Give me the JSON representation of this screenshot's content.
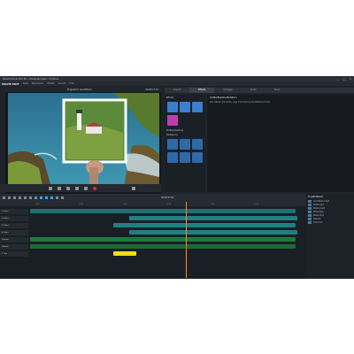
{
  "window": {
    "title": "MAGIX Movie Edit Pro - Beispielprojekt - Timeline",
    "logo": "MOVIE EDIT",
    "window_controls": [
      "_",
      "□",
      "×"
    ]
  },
  "menu": {
    "items": [
      "Datei",
      "Bearbeiten",
      "Effekte",
      "Ansicht",
      "Hilfe"
    ]
  },
  "monitor": {
    "header_label": "Programm: Leuchtturm",
    "timecode": "00:00:17:01"
  },
  "right_panel": {
    "tabs": [
      "Import",
      "Effekte",
      "Vorlagen",
      "Audio",
      "Store"
    ],
    "active_tab": "Effekte",
    "effects_header": "Effekte",
    "effects_group_label": "Bildbearbeitung",
    "effects_group2_label": "Bewegung",
    "description_title": "Größe/Position/Rotation",
    "description_text": "Hier wählen Sie Größe, Lage und Drehung des Bildausschnitts."
  },
  "toolbar": {
    "time_display": "00:00:17:01"
  },
  "timeline": {
    "ruler_labels": [
      "0:00",
      "0:05",
      "0:10",
      "0:15",
      "0:20",
      "0:25"
    ],
    "tracks": [
      {
        "label": "1 Video"
      },
      {
        "label": "2 Video"
      },
      {
        "label": "3 Video"
      },
      {
        "label": "4 Video"
      },
      {
        "label": "5 Audio"
      },
      {
        "label": "6 Audio"
      },
      {
        "label": "7 Titel"
      }
    ]
  },
  "media_pool": {
    "title": "Projektdateien",
    "items": [
      "Leuchtturm.mp4",
      "Küste.mp4",
      "Wellen.mp4",
      "Strand.jpg",
      "Musik.mp3",
      "Titel.txt",
      "Intro.mov"
    ]
  },
  "colors": {
    "accent": "#3da5ff",
    "clip_teal": "#1f7f82",
    "clip_green": "#1d7a3e",
    "title_clip": "#e8e020",
    "playhead": "#ff8a2a"
  }
}
